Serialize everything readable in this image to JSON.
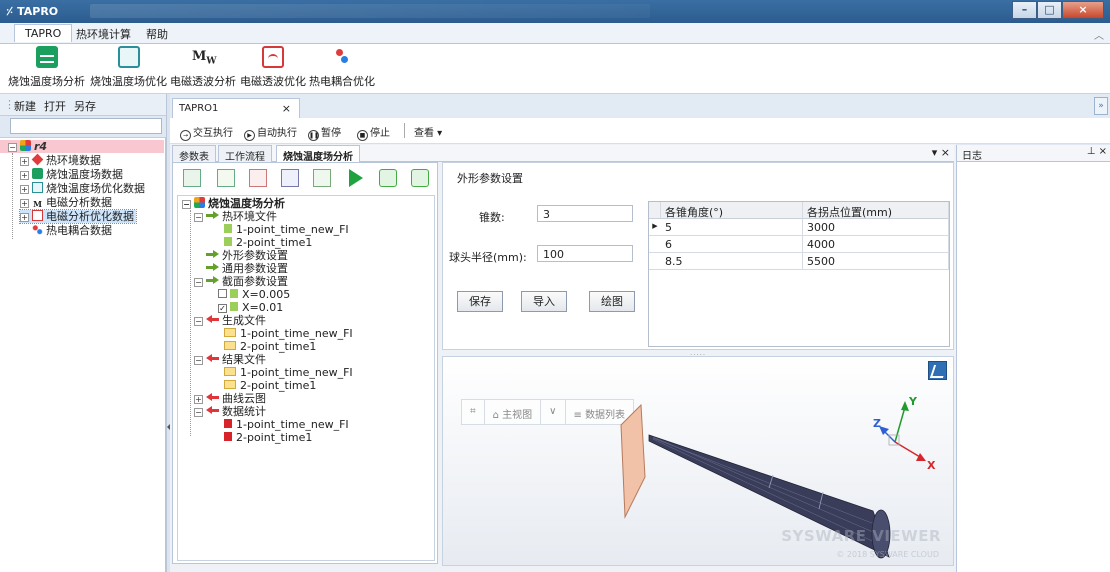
{
  "window": {
    "title": "TAPRO"
  },
  "menu": {
    "items": [
      "TAPRO",
      "热环境计算",
      "帮助"
    ]
  },
  "ribbon": {
    "buttons": [
      {
        "label": "烧蚀温度场分析",
        "icon": "waveform-icon"
      },
      {
        "label": "烧蚀温度场优化",
        "icon": "frame-icon"
      },
      {
        "label": "电磁透波分析",
        "icon": "mw-icon",
        "glyph": "M\nW"
      },
      {
        "label": "电磁透波优化",
        "icon": "hill-curve-icon"
      },
      {
        "label": "热电耦合优化",
        "icon": "coupled-dots-icon"
      }
    ]
  },
  "left_toolbar": {
    "new": "新建",
    "open": "打开",
    "save_as": "另存"
  },
  "left_tree": {
    "root": "r4",
    "items": [
      "热环境数据",
      "烧蚀温度场数据",
      "烧蚀温度场优化数据",
      "电磁分析数据",
      "电磁分析优化数据",
      "热电耦合数据"
    ]
  },
  "doc_tab": {
    "label": "TAPRO1",
    "close": "×"
  },
  "exec_toolbar": {
    "interactive": "交互执行",
    "auto": "自动执行",
    "pause": "暂停",
    "stop": "停止",
    "view": "查看"
  },
  "sub_tabs": [
    "参数表",
    "工作流程",
    "烧蚀温度场分析"
  ],
  "analysis_tree": {
    "root": "烧蚀温度场分析",
    "thermal_files": "热环境文件",
    "thermal_file_1": "1-point_time_new_FI",
    "thermal_file_2": "2-point_time1",
    "shape_settings": "外形参数设置",
    "general_settings": "通用参数设置",
    "section_settings": "截面参数设置",
    "section_1": "X=0.005",
    "section_2": "X=0.01",
    "gen_files": "生成文件",
    "gen_file_1": "1-point_time_new_FI",
    "gen_file_2": "2-point_time1",
    "result_files": "结果文件",
    "result_file_1": "1-point_time_new_FI",
    "result_file_2": "2-point_time1",
    "contour": "曲线云图",
    "stats": "数据统计",
    "stats_1": "1-point_time_new_FI",
    "stats_2": "2-point_time1"
  },
  "form": {
    "title": "外形参数设置",
    "cone_count_label": "锥数:",
    "cone_count_value": "3",
    "nose_radius_label": "球头半径(mm):",
    "nose_radius_value": "100",
    "save": "保存",
    "import": "导入",
    "plot": "绘图",
    "grid": {
      "headers": [
        "各锥角度(°)",
        "各拐点位置(mm)"
      ],
      "rows": [
        [
          "5",
          "3000"
        ],
        [
          "6",
          "4000"
        ],
        [
          "8.5",
          "5500"
        ]
      ]
    }
  },
  "viewer": {
    "toolbar": {
      "fit": "⌗",
      "home": "主视图",
      "list": "数据列表"
    },
    "watermark": "SYSWARE VIEWER",
    "watermark_sub": "© 2018 SYSWARE CLOUD",
    "axes": {
      "x": "X",
      "y": "Y",
      "z": "Z"
    }
  },
  "log": {
    "title": "日志"
  },
  "colors": {
    "titlebar": "#2c5c8f",
    "accent_green": "#1fa23f",
    "accent_red": "#e0363a",
    "cone": "#3a3d5a"
  }
}
